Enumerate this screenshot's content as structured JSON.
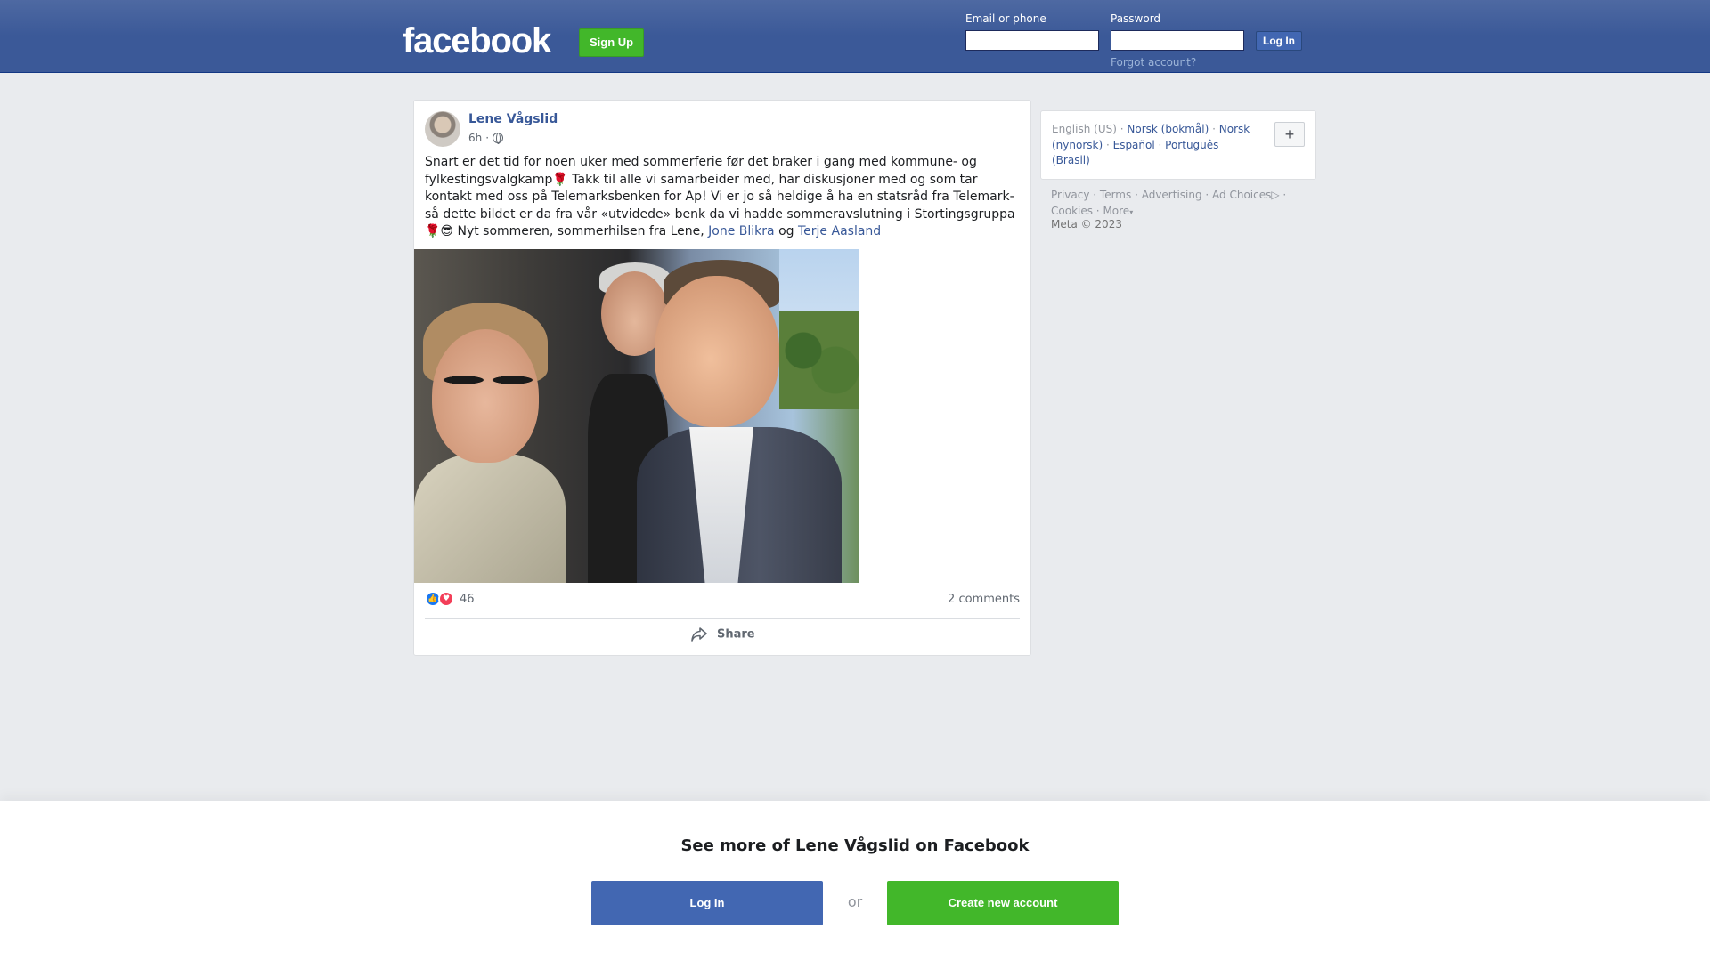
{
  "header": {
    "logo": "facebook",
    "signup_label": "Sign Up",
    "email_label": "Email or phone",
    "email_value": "",
    "password_label": "Password",
    "password_value": "",
    "login_label": "Log In",
    "forgot_label": "Forgot account?"
  },
  "post": {
    "author": "Lene Vågslid",
    "time": "6h",
    "visibility_icon": "globe-icon",
    "text_main": "Snart er det tid for noen uker med sommerferie før det braker i gang med kommune- og fylkestingsvalgkamp🌹 Takk til alle vi samarbeider med, har diskusjoner med og som tar kontakt med oss på Telemarksbenken for Ap! Vi er jo så heldige å ha en statsråd fra Telemark- så dette bildet er da fra vår «utvidede» benk da vi hadde sommeravslutning i Stortingsgruppa 🌹😎 Nyt sommeren, sommerhilsen fra Lene,",
    "tag1": "Jone Blikra",
    "text_og": "og",
    "tag2": "Terje Aasland",
    "reaction_count": "46",
    "comments": "2 comments",
    "share_label": "Share"
  },
  "sidebar": {
    "current_language": "English (US)",
    "languages": [
      "Norsk (bokmål)",
      "Norsk (nynorsk)",
      "Español",
      "Português (Brasil)"
    ],
    "more_languages_label": "+",
    "footer_links": [
      "Privacy",
      "Terms",
      "Advertising",
      "Ad Choices",
      "Cookies",
      "More"
    ],
    "copyright": "Meta © 2023"
  },
  "bottom": {
    "title": "See more of Lene Vågslid on Facebook",
    "login_label": "Log In",
    "or_label": "or",
    "create_label": "Create new account"
  },
  "colors": {
    "brand_blue": "#3b5998",
    "link_blue": "#385898",
    "green": "#42b72a",
    "button_blue": "#4267b2"
  }
}
